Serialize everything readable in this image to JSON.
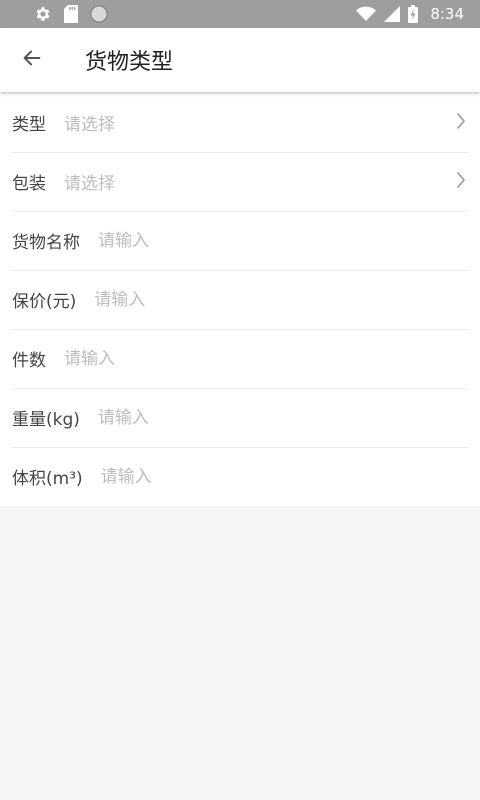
{
  "status_bar": {
    "time": "8:34",
    "icons": [
      "settings-icon",
      "sd-card-icon",
      "circle-icon",
      "wifi-icon",
      "signal-icon",
      "battery-charging-icon"
    ]
  },
  "app_bar": {
    "back_icon": "arrow-back-icon",
    "title": "货物类型"
  },
  "form": {
    "rows": [
      {
        "label": "类型",
        "placeholder": "请选择",
        "kind": "select"
      },
      {
        "label": "包装",
        "placeholder": "请选择",
        "kind": "select"
      },
      {
        "label": "货物名称",
        "placeholder": "请输入",
        "kind": "input"
      },
      {
        "label": "保价(元)",
        "placeholder": "请输入",
        "kind": "input"
      },
      {
        "label": "件数",
        "placeholder": "请输入",
        "kind": "input"
      },
      {
        "label": "重量(kg)",
        "placeholder": "请输入",
        "kind": "input"
      },
      {
        "label": "体积(m³)",
        "placeholder": "请输入",
        "kind": "input"
      }
    ]
  },
  "colors": {
    "status_bar": "#9e9e9e",
    "app_bar": "#ffffff",
    "background": "#f5f5f5",
    "label": "#444444",
    "placeholder": "#bdbdbd"
  }
}
